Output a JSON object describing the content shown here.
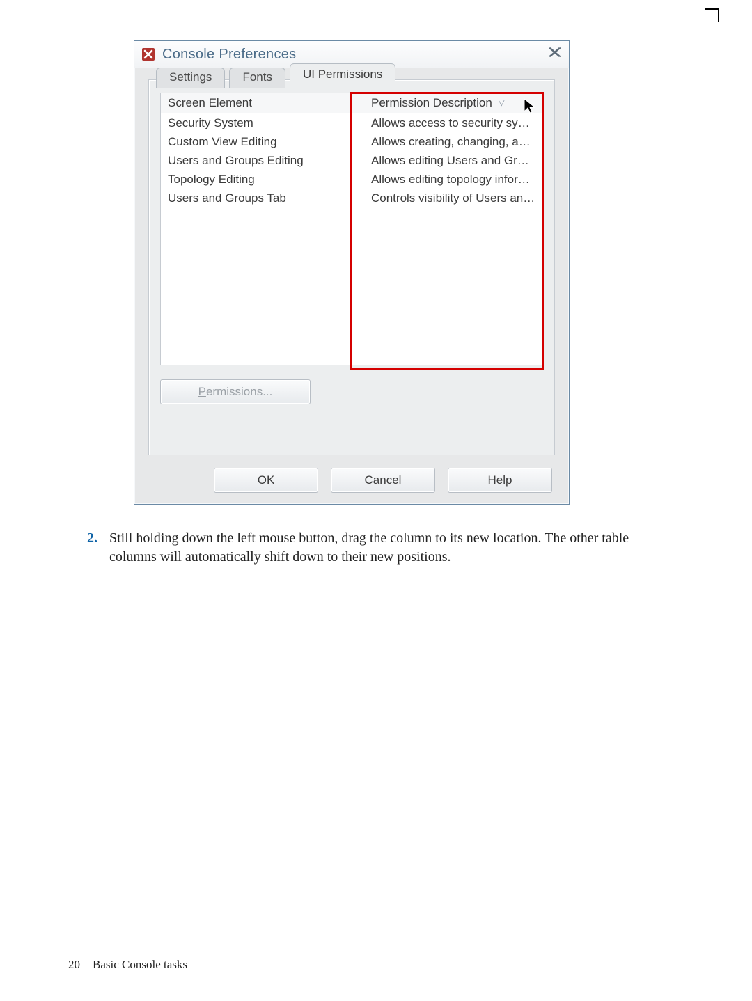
{
  "dialog": {
    "title": "Console Preferences",
    "close_label": "Close",
    "tabs": [
      {
        "label": "Settings"
      },
      {
        "label": "Fonts"
      },
      {
        "label": "UI Permissions"
      }
    ],
    "table": {
      "header_col1": "Screen Element",
      "header_col2": "Permission Description",
      "sort_indicator": "▽",
      "rows": [
        {
          "element": "Security System",
          "desc": "Allows access to security system."
        },
        {
          "element": "Custom View Editing",
          "desc": "Allows creating, changing, and d..."
        },
        {
          "element": "Users and Groups Editing",
          "desc": "Allows editing Users and Groups..."
        },
        {
          "element": "Topology Editing",
          "desc": "Allows editing topology informati..."
        },
        {
          "element": "Users and Groups Tab",
          "desc": "Controls visibility of Users and Gr..."
        }
      ]
    },
    "permissions_button_prefix": "P",
    "permissions_button_rest": "ermissions...",
    "ok_label": "OK",
    "cancel_label": "Cancel",
    "help_label": "Help"
  },
  "instruction": {
    "number": "2.",
    "text": "Still holding down the left mouse button, drag the column to its new location. The other table columns will automatically shift down to their new positions."
  },
  "footer": {
    "page_number": "20",
    "section": "Basic Console tasks"
  }
}
